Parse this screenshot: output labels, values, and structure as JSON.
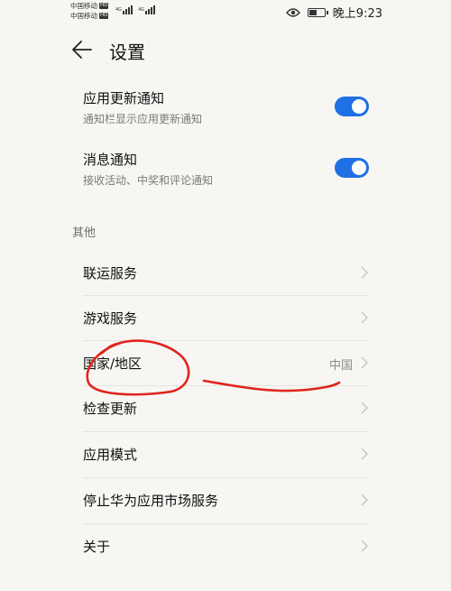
{
  "status_bar": {
    "carrier_1": "中国移动",
    "carrier_2": "中国移动",
    "hd_label": "HD",
    "network_1": "4G",
    "network_2": "4G",
    "time": "晚上9:23"
  },
  "header": {
    "title": "设置"
  },
  "toggles": [
    {
      "title": "应用更新通知",
      "subtitle": "通知栏显示应用更新通知",
      "enabled": true
    },
    {
      "title": "消息通知",
      "subtitle": "接收活动、中奖和评论通知",
      "enabled": true
    }
  ],
  "section": {
    "title": "其他"
  },
  "items": [
    {
      "label": "联运服务",
      "value": ""
    },
    {
      "label": "游戏服务",
      "value": ""
    },
    {
      "label": "国家/地区",
      "value": "中国"
    },
    {
      "label": "检查更新",
      "value": ""
    },
    {
      "label": "应用模式",
      "value": ""
    },
    {
      "label": "停止华为应用市场服务",
      "value": ""
    },
    {
      "label": "关于",
      "value": ""
    }
  ],
  "colors": {
    "accent": "#1f6fe5",
    "annotation": "#e0241c",
    "background": "#f7f6f3"
  }
}
